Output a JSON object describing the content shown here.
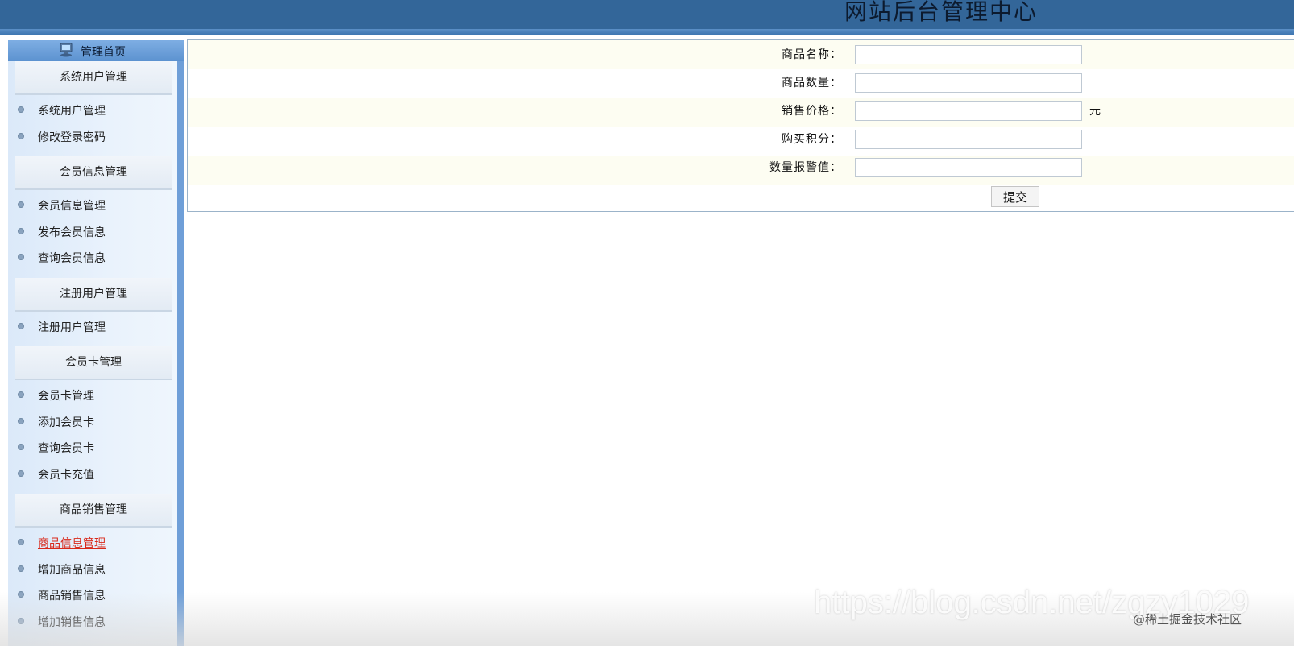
{
  "header": {
    "title": "网站后台管理中心"
  },
  "sidebar": {
    "home_label": "管理首页",
    "sections": [
      {
        "title": "系统用户管理",
        "items": [
          "系统用户管理",
          "修改登录密码"
        ]
      },
      {
        "title": "会员信息管理",
        "items": [
          "会员信息管理",
          "发布会员信息",
          "查询会员信息"
        ]
      },
      {
        "title": "注册用户管理",
        "items": [
          "注册用户管理"
        ]
      },
      {
        "title": "会员卡管理",
        "items": [
          "会员卡管理",
          "添加会员卡",
          "查询会员卡",
          "会员卡充值"
        ]
      },
      {
        "title": "商品销售管理",
        "items": [
          "商品信息管理",
          "增加商品信息",
          "商品销售信息",
          "增加销售信息"
        ]
      }
    ],
    "active_item": "商品信息管理"
  },
  "form": {
    "fields": [
      {
        "label": "商品名称：",
        "value": "",
        "unit": ""
      },
      {
        "label": "商品数量：",
        "value": "",
        "unit": ""
      },
      {
        "label": "销售价格：",
        "value": "",
        "unit": "元"
      },
      {
        "label": "购买积分：",
        "value": "",
        "unit": ""
      },
      {
        "label": "数量报警值：",
        "value": "",
        "unit": ""
      }
    ],
    "submit_label": "提交"
  },
  "watermark": {
    "url": "https://blog.csdn.net/zgzy1029",
    "site": "@稀土掘金技术社区"
  },
  "colors": {
    "header_bg": "#336699",
    "sidebar_border": "#6f9fd8",
    "active_link": "#d9281a"
  }
}
